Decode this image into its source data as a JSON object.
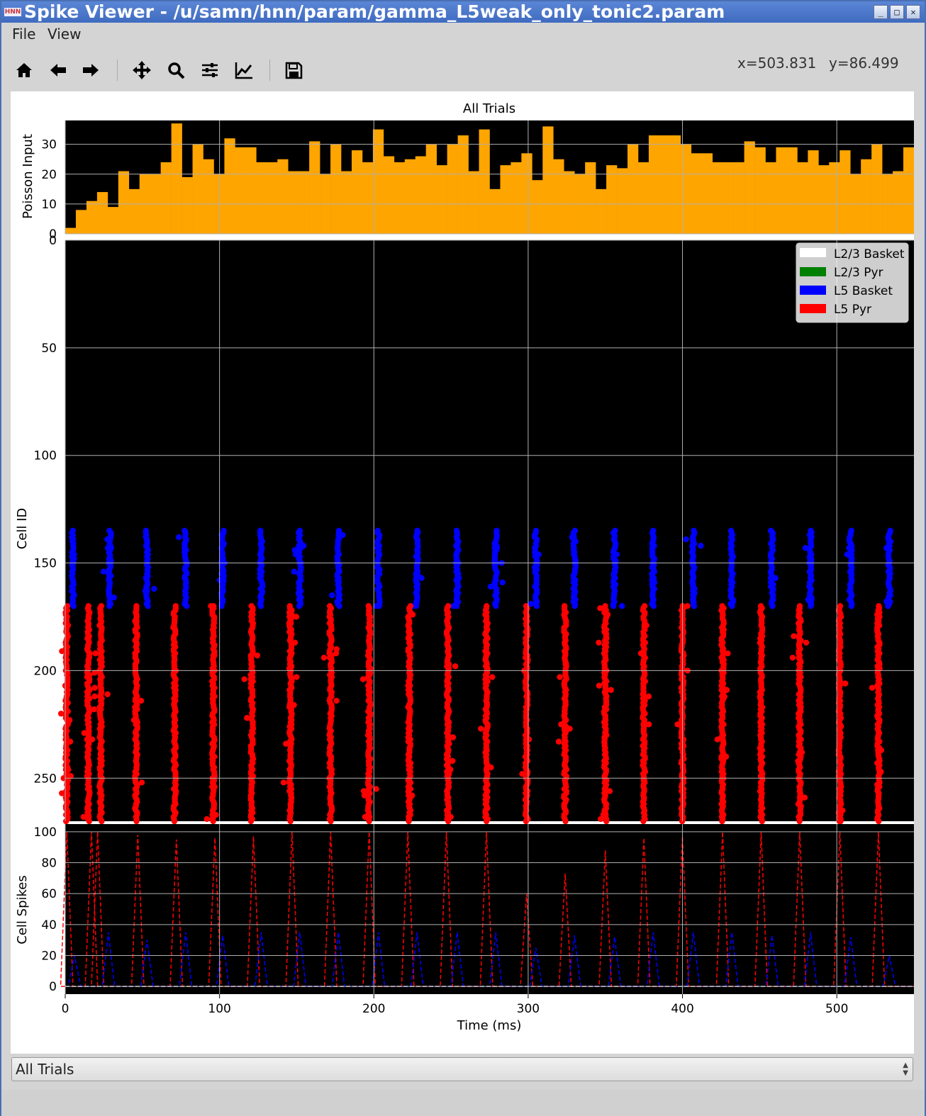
{
  "window": {
    "title": "Spike Viewer - /u/samn/hnn/param/gamma_L5weak_only_tonic2.param",
    "app_icon_text": "HNN",
    "minimize_glyph": "_",
    "maximize_glyph": "□",
    "close_glyph": "✕"
  },
  "menu": {
    "file": "File",
    "view": "View"
  },
  "toolbar": {
    "icons": [
      "home-icon",
      "back-arrow-icon",
      "forward-arrow-icon",
      "pan-icon",
      "zoom-icon",
      "subplots-config-icon",
      "axes-edit-icon",
      "save-icon"
    ],
    "x_readout": "x=503.831",
    "y_readout": "y=86.499"
  },
  "figure": {
    "title": "All Trials",
    "colors": {
      "plot_bg": "#000000",
      "histogram": "#ffa500",
      "l23_basket": "#ffffff",
      "l23_pyr": "#008000",
      "l5_basket": "#0000ff",
      "l5_pyr": "#ff0000",
      "grid": "#b0b0b0"
    }
  },
  "chart_data": [
    {
      "type": "bar",
      "ylabel": "Poisson Input",
      "xlim": [
        0,
        550
      ],
      "ylim": [
        0,
        38
      ],
      "yticks": [
        "0",
        "10",
        "20",
        "30"
      ],
      "bin_width_ms": 6.875,
      "values": [
        2,
        8,
        11,
        14,
        9,
        21,
        15,
        20,
        20,
        24,
        37,
        19,
        30,
        25,
        20,
        32,
        29,
        29,
        24,
        24,
        25,
        21,
        21,
        31,
        20,
        30,
        21,
        28,
        24,
        35,
        26,
        24,
        25,
        26,
        30,
        23,
        30,
        33,
        21,
        35,
        15,
        23,
        24,
        27,
        18,
        36,
        25,
        21,
        20,
        24,
        15,
        23,
        22,
        30,
        24,
        33,
        33,
        33,
        30,
        27,
        27,
        24,
        24,
        24,
        31,
        29,
        24,
        29,
        29,
        24,
        28,
        23,
        24,
        28,
        20,
        25,
        30,
        20,
        21,
        29,
        28,
        22,
        25
      ]
    },
    {
      "type": "scatter",
      "ylabel": "Cell ID",
      "xlim": [
        0,
        550
      ],
      "ylim": [
        270,
        0
      ],
      "yticks": [
        "0",
        "50",
        "100",
        "150",
        "200",
        "250"
      ],
      "legend": {
        "placement": "top-right",
        "entries": [
          {
            "label": "L2/3 Basket",
            "color": "#ffffff"
          },
          {
            "label": "L2/3 Pyr",
            "color": "#008000"
          },
          {
            "label": "L5 Basket",
            "color": "#0000ff"
          },
          {
            "label": "L5 Pyr",
            "color": "#ff0000"
          }
        ]
      },
      "series": [
        {
          "name": "L5 Basket",
          "cell_range": [
            135,
            170
          ],
          "spike_times": [
            5,
            29,
            53,
            78,
            102,
            127,
            152,
            177,
            203,
            228,
            254,
            279,
            305,
            330,
            356,
            381,
            407,
            432,
            458,
            483,
            509,
            534
          ]
        },
        {
          "name": "L5 Pyr",
          "cell_range": [
            170,
            270
          ],
          "spike_times": [
            1,
            15,
            23,
            46,
            71,
            96,
            121,
            146,
            172,
            197,
            223,
            248,
            273,
            299,
            324,
            350,
            375,
            400,
            426,
            451,
            476,
            502,
            527
          ]
        }
      ]
    },
    {
      "type": "line",
      "ylabel": "Cell Spikes",
      "xlabel": "Time (ms)",
      "xlim": [
        0,
        550
      ],
      "ylim": [
        -5,
        105
      ],
      "xticks": [
        "0",
        "100",
        "200",
        "300",
        "400",
        "500"
      ],
      "yticks": [
        "0",
        "20",
        "40",
        "60",
        "80",
        "100"
      ],
      "series": [
        {
          "name": "L5 Pyr",
          "peaks": [
            [
              1,
              100
            ],
            [
              17,
              100
            ],
            [
              21,
              100
            ],
            [
              47,
              98
            ],
            [
              72,
              95
            ],
            [
              97,
              96
            ],
            [
              122,
              97
            ],
            [
              147,
              100
            ],
            [
              172,
              100
            ],
            [
              197,
              100
            ],
            [
              222,
              100
            ],
            [
              247,
              100
            ],
            [
              273,
              100
            ],
            [
              299,
              60
            ],
            [
              324,
              73
            ],
            [
              350,
              88
            ],
            [
              375,
              96
            ],
            [
              400,
              97
            ],
            [
              426,
              100
            ],
            [
              451,
              100
            ],
            [
              476,
              100
            ],
            [
              502,
              100
            ],
            [
              527,
              100
            ]
          ]
        },
        {
          "name": "L5 Basket",
          "peaks": [
            [
              6,
              20
            ],
            [
              28,
              35
            ],
            [
              53,
              30
            ],
            [
              78,
              35
            ],
            [
              102,
              33
            ],
            [
              127,
              35
            ],
            [
              152,
              35
            ],
            [
              177,
              35
            ],
            [
              203,
              35
            ],
            [
              228,
              35
            ],
            [
              254,
              35
            ],
            [
              279,
              35
            ],
            [
              305,
              25
            ],
            [
              330,
              33
            ],
            [
              356,
              32
            ],
            [
              381,
              35
            ],
            [
              407,
              35
            ],
            [
              432,
              35
            ],
            [
              458,
              33
            ],
            [
              483,
              35
            ],
            [
              509,
              32
            ],
            [
              534,
              20
            ]
          ]
        },
        {
          "name": "L2/3 Basket",
          "constant": 0
        }
      ]
    }
  ],
  "trial_selector": {
    "value": "All Trials"
  }
}
